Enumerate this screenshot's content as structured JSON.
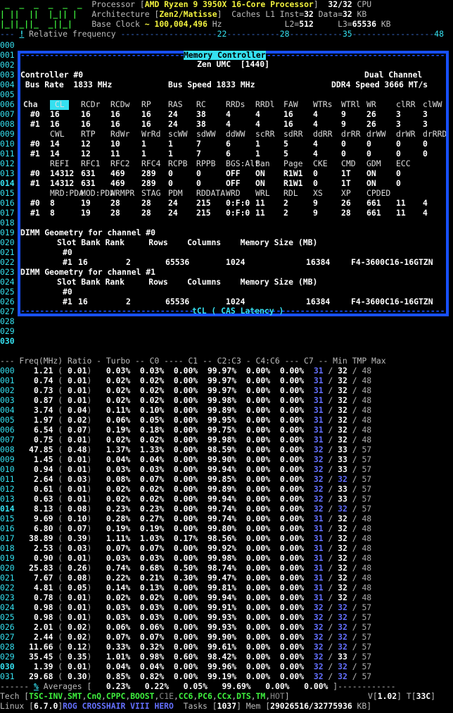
{
  "header": {
    "processor_label": "Processor",
    "processor_name": "AMD Ryzen 9 3950X 16-Core Processor",
    "cpu_count": "32/32",
    "cpu_unit": "CPU",
    "arch_label": "Architecture",
    "arch_name": "Zen2/Matisse",
    "caches_label": "Caches L1 Inst=",
    "l1_inst": "32",
    "l1_data_label": "Data=",
    "l1_data": "32",
    "l1_unit": "KB",
    "base_clock_label": "Base Clock",
    "base_clock_value": "~ 100,004,496",
    "base_clock_unit": "Hz",
    "l2_label": "L2=",
    "l2": "512",
    "l3_label": "L3=",
    "l3": "65536",
    "l3_unit": "KB",
    "ruler_prefix": "---",
    "ruler_excl": "!",
    "ruler_label": "Relative frequency",
    "ruler_marks": [
      "22",
      "28",
      "35",
      "48"
    ]
  },
  "left_gutter_top": [
    "000",
    "001",
    "002",
    "003",
    "004",
    "005",
    "006",
    "007",
    "008",
    "009",
    "010",
    "011",
    "012",
    "013",
    "014",
    "015",
    "016",
    "017",
    "018",
    "019",
    "020",
    "021",
    "022",
    "023",
    "024",
    "025",
    "026",
    "027",
    "028",
    "029",
    "030"
  ],
  "memory_panel": {
    "title": "Memory Controller",
    "subtitle": "Zen UMC  [1440]",
    "controller_label": "Controller #0",
    "channel_mode": "Dual Channel",
    "bus_rate": "Bus Rate  1833 MHz",
    "bus_speed": "Bus Speed 1833 MHz",
    "ddr_speed": "DDR4 Speed 3666 MT/s",
    "timing_rows": [
      {
        "label": "Cha",
        "cells": [
          "CL",
          "RCDr",
          "RCDw",
          "RP",
          "RAS",
          "RC",
          "RRDs",
          "RRDl",
          "FAW",
          "WTRs",
          "WTRl",
          "WR",
          "clRR",
          "clWW"
        ],
        "header": true
      },
      {
        "label": "#0",
        "cells": [
          "16",
          "16",
          "16",
          "16",
          "24",
          "38",
          "4",
          "4",
          "16",
          "4",
          "9",
          "26",
          "3",
          "3"
        ]
      },
      {
        "label": "#1",
        "cells": [
          "16",
          "16",
          "16",
          "16",
          "24",
          "38",
          "4",
          "4",
          "16",
          "4",
          "9",
          "26",
          "3",
          "3"
        ]
      },
      {
        "label": "",
        "cells": [
          "CWL",
          "RTP",
          "RdWr",
          "WrRd",
          "scWW",
          "sdWW",
          "ddWW",
          "scRR",
          "sdRR",
          "ddRR",
          "drRR",
          "drWW",
          "drWR",
          "drRRD"
        ],
        "header": true
      },
      {
        "label": "#0",
        "cells": [
          "14",
          "12",
          "10",
          "1",
          "1",
          "7",
          "6",
          "1",
          "5",
          "4",
          "0",
          "0",
          "0",
          "0"
        ]
      },
      {
        "label": "#1",
        "cells": [
          "14",
          "12",
          "11",
          "1",
          "1",
          "7",
          "6",
          "1",
          "5",
          "4",
          "0",
          "0",
          "0",
          "0"
        ]
      },
      {
        "label": "",
        "cells": [
          "REFI",
          "RFC1",
          "RFC2",
          "RFC4",
          "RCPB",
          "RPPB",
          "BGS:Alt",
          "Ban",
          "Page",
          "CKE",
          "CMD",
          "GDM",
          "ECC"
        ],
        "header": true
      },
      {
        "label": "#0",
        "cells": [
          "14312",
          "631",
          "469",
          "289",
          "0",
          "0",
          "OFF",
          "ON",
          "R1W1",
          "0",
          "1T",
          "ON",
          "0"
        ]
      },
      {
        "label": "#1",
        "cells": [
          "14312",
          "631",
          "469",
          "289",
          "0",
          "0",
          "OFF",
          "ON",
          "R1W1",
          "0",
          "1T",
          "ON",
          "0"
        ]
      },
      {
        "label": "",
        "cells": [
          "MRD:PDA",
          "MOD:PDA",
          "WRMPR",
          "STAG",
          "PDM",
          "RDDATA",
          "WRD",
          "WRL",
          "RDL",
          "XS",
          "XP",
          "CPDED"
        ],
        "header": true
      },
      {
        "label": "#0",
        "cells": [
          "8",
          "19",
          "28",
          "28",
          "24",
          "215",
          "0:F:0",
          "11",
          "2",
          "9",
          "26",
          "661",
          "11",
          "4"
        ]
      },
      {
        "label": "#1",
        "cells": [
          "8",
          "19",
          "28",
          "28",
          "24",
          "215",
          "0:F:0",
          "11",
          "2",
          "9",
          "28",
          "661",
          "11",
          "4"
        ]
      }
    ],
    "dimm_title_0": "DIMM Geometry for channel #0",
    "dimm_title_1": "DIMM Geometry for channel #1",
    "dimm_header": "Slot Bank Rank     Rows    Columns    Memory Size (MB)",
    "dimm_slot0": "#0",
    "dimm_row": {
      "slot": "#1",
      "bank": "16",
      "rank": "2",
      "rows": "65536",
      "columns": "1024",
      "size": "16384",
      "part": "F4-3600C16-16GTZN"
    },
    "footer": "tCL ( CAS Latency )"
  },
  "table": {
    "header": "--- Freq(MHz) Ratio - Turbo -- C0 ---- C1 -- C2:C3 - C4:C6 --- C7 -- Min TMP Max",
    "rows": [
      [
        "000",
        "1.21",
        "0.01",
        "0.03%",
        "0.03%",
        "0.00%",
        "99.97%",
        "0.00%",
        "0.00%",
        "31",
        "32",
        "48"
      ],
      [
        "001",
        "0.74",
        "0.01",
        "0.02%",
        "0.02%",
        "0.00%",
        "99.97%",
        "0.00%",
        "0.00%",
        "31",
        "32",
        "48"
      ],
      [
        "002",
        "0.73",
        "0.01",
        "0.02%",
        "0.02%",
        "0.00%",
        "99.97%",
        "0.00%",
        "0.00%",
        "31",
        "32",
        "48"
      ],
      [
        "003",
        "0.87",
        "0.01",
        "0.02%",
        "0.02%",
        "0.00%",
        "99.98%",
        "0.00%",
        "0.00%",
        "31",
        "32",
        "48"
      ],
      [
        "004",
        "3.74",
        "0.04",
        "0.11%",
        "0.10%",
        "0.00%",
        "99.89%",
        "0.00%",
        "0.00%",
        "31",
        "32",
        "48"
      ],
      [
        "005",
        "1.97",
        "0.02",
        "0.06%",
        "0.05%",
        "0.00%",
        "99.95%",
        "0.00%",
        "0.00%",
        "31",
        "32",
        "48"
      ],
      [
        "006",
        "6.54",
        "0.07",
        "0.19%",
        "0.18%",
        "0.00%",
        "99.75%",
        "0.00%",
        "0.00%",
        "31",
        "32",
        "48"
      ],
      [
        "007",
        "0.75",
        "0.01",
        "0.02%",
        "0.02%",
        "0.00%",
        "99.98%",
        "0.00%",
        "0.00%",
        "31",
        "32",
        "48"
      ],
      [
        "008",
        "47.85",
        "0.48",
        "1.37%",
        "1.33%",
        "0.00%",
        "98.59%",
        "0.00%",
        "0.00%",
        "32",
        "33",
        "57"
      ],
      [
        "009",
        "1.45",
        "0.01",
        "0.04%",
        "0.04%",
        "0.00%",
        "99.90%",
        "0.00%",
        "0.00%",
        "32",
        "33",
        "57"
      ],
      [
        "010",
        "0.94",
        "0.01",
        "0.03%",
        "0.03%",
        "0.00%",
        "99.94%",
        "0.00%",
        "0.00%",
        "32",
        "33",
        "57"
      ],
      [
        "011",
        "2.64",
        "0.03",
        "0.08%",
        "0.07%",
        "0.00%",
        "99.85%",
        "0.00%",
        "0.00%",
        "32",
        "32",
        "57"
      ],
      [
        "012",
        "0.61",
        "0.01",
        "0.02%",
        "0.02%",
        "0.00%",
        "99.89%",
        "0.00%",
        "0.00%",
        "32",
        "33",
        "57"
      ],
      [
        "013",
        "0.63",
        "0.01",
        "0.02%",
        "0.02%",
        "0.00%",
        "99.94%",
        "0.00%",
        "0.00%",
        "32",
        "33",
        "57"
      ],
      [
        "014",
        "8.13",
        "0.08",
        "0.23%",
        "0.23%",
        "0.00%",
        "99.74%",
        "0.00%",
        "0.00%",
        "32",
        "32",
        "57"
      ],
      [
        "015",
        "9.69",
        "0.10",
        "0.28%",
        "0.27%",
        "0.00%",
        "99.74%",
        "0.00%",
        "0.00%",
        "31",
        "32",
        "48"
      ],
      [
        "016",
        "6.80",
        "0.07",
        "0.19%",
        "0.19%",
        "0.00%",
        "99.80%",
        "0.00%",
        "0.00%",
        "31",
        "32",
        "48"
      ],
      [
        "017",
        "38.89",
        "0.39",
        "1.11%",
        "1.03%",
        "0.17%",
        "98.56%",
        "0.00%",
        "0.00%",
        "31",
        "32",
        "48"
      ],
      [
        "018",
        "2.53",
        "0.03",
        "0.07%",
        "0.07%",
        "0.00%",
        "99.92%",
        "0.00%",
        "0.00%",
        "31",
        "32",
        "48"
      ],
      [
        "019",
        "0.90",
        "0.01",
        "0.03%",
        "0.03%",
        "0.00%",
        "99.98%",
        "0.00%",
        "0.00%",
        "31",
        "32",
        "48"
      ],
      [
        "020",
        "25.83",
        "0.26",
        "0.74%",
        "0.68%",
        "0.50%",
        "98.74%",
        "0.00%",
        "0.00%",
        "31",
        "32",
        "48"
      ],
      [
        "021",
        "7.67",
        "0.08",
        "0.22%",
        "0.21%",
        "0.30%",
        "99.47%",
        "0.00%",
        "0.00%",
        "31",
        "32",
        "48"
      ],
      [
        "022",
        "4.81",
        "0.05",
        "0.14%",
        "0.13%",
        "0.00%",
        "99.81%",
        "0.00%",
        "0.00%",
        "31",
        "32",
        "48"
      ],
      [
        "023",
        "0.78",
        "0.01",
        "0.02%",
        "0.02%",
        "0.00%",
        "99.94%",
        "0.00%",
        "0.00%",
        "31",
        "32",
        "48"
      ],
      [
        "024",
        "0.98",
        "0.01",
        "0.03%",
        "0.03%",
        "0.00%",
        "99.91%",
        "0.00%",
        "0.00%",
        "32",
        "32",
        "57"
      ],
      [
        "025",
        "0.98",
        "0.01",
        "0.03%",
        "0.03%",
        "0.00%",
        "99.93%",
        "0.00%",
        "0.00%",
        "32",
        "32",
        "57"
      ],
      [
        "026",
        "2.01",
        "0.02",
        "0.06%",
        "0.06%",
        "0.00%",
        "99.93%",
        "0.00%",
        "0.00%",
        "32",
        "32",
        "57"
      ],
      [
        "027",
        "2.44",
        "0.02",
        "0.07%",
        "0.07%",
        "0.00%",
        "99.90%",
        "0.00%",
        "0.00%",
        "32",
        "32",
        "57"
      ],
      [
        "028",
        "11.66",
        "0.12",
        "0.33%",
        "0.32%",
        "0.00%",
        "99.61%",
        "0.00%",
        "0.00%",
        "32",
        "32",
        "57"
      ],
      [
        "029",
        "35.45",
        "0.35",
        "1.01%",
        "0.98%",
        "0.60%",
        "98.42%",
        "0.00%",
        "0.00%",
        "32",
        "33",
        "57"
      ],
      [
        "030",
        "1.39",
        "0.01",
        "0.04%",
        "0.04%",
        "0.00%",
        "99.96%",
        "0.00%",
        "0.00%",
        "32",
        "32",
        "57"
      ],
      [
        "031",
        "29.68",
        "0.30",
        "0.85%",
        "0.82%",
        "0.00%",
        "99.19%",
        "0.00%",
        "0.00%",
        "32",
        "32",
        "57"
      ]
    ],
    "averages_prefix": "------",
    "averages_pct": "%",
    "averages_label": "Averages [",
    "averages": [
      "0.23%",
      "0.22%",
      "0.05%",
      "99.69%",
      "0.00%",
      "0.00%"
    ],
    "averages_end": "]"
  },
  "footer": {
    "tech_label": "Tech [",
    "tech_items_on": [
      "TSC-INV",
      "SMT",
      "CnQ",
      "CPPC",
      "BOOST"
    ],
    "tech_c1e": "C1E",
    "tech_items_on2": [
      "CC6",
      "PC6"
    ],
    "tech_items_on3": [
      "CCx",
      "DTS",
      "TM"
    ],
    "tech_hot": "HOT",
    "tech_end": "]",
    "v_label": "V[",
    "v_value": "1.02",
    "t_label": "] T[",
    "t_value": "33C",
    "os_label": "Linux [",
    "kernel": "6.7.0",
    "board": "ROG CROSSHAIR VIII HERO",
    "tasks_label": "Tasks [",
    "tasks_value": "1037",
    "mem_label": "Mem [",
    "mem_value": "29026516/32775936",
    "mem_unit": "KB"
  }
}
